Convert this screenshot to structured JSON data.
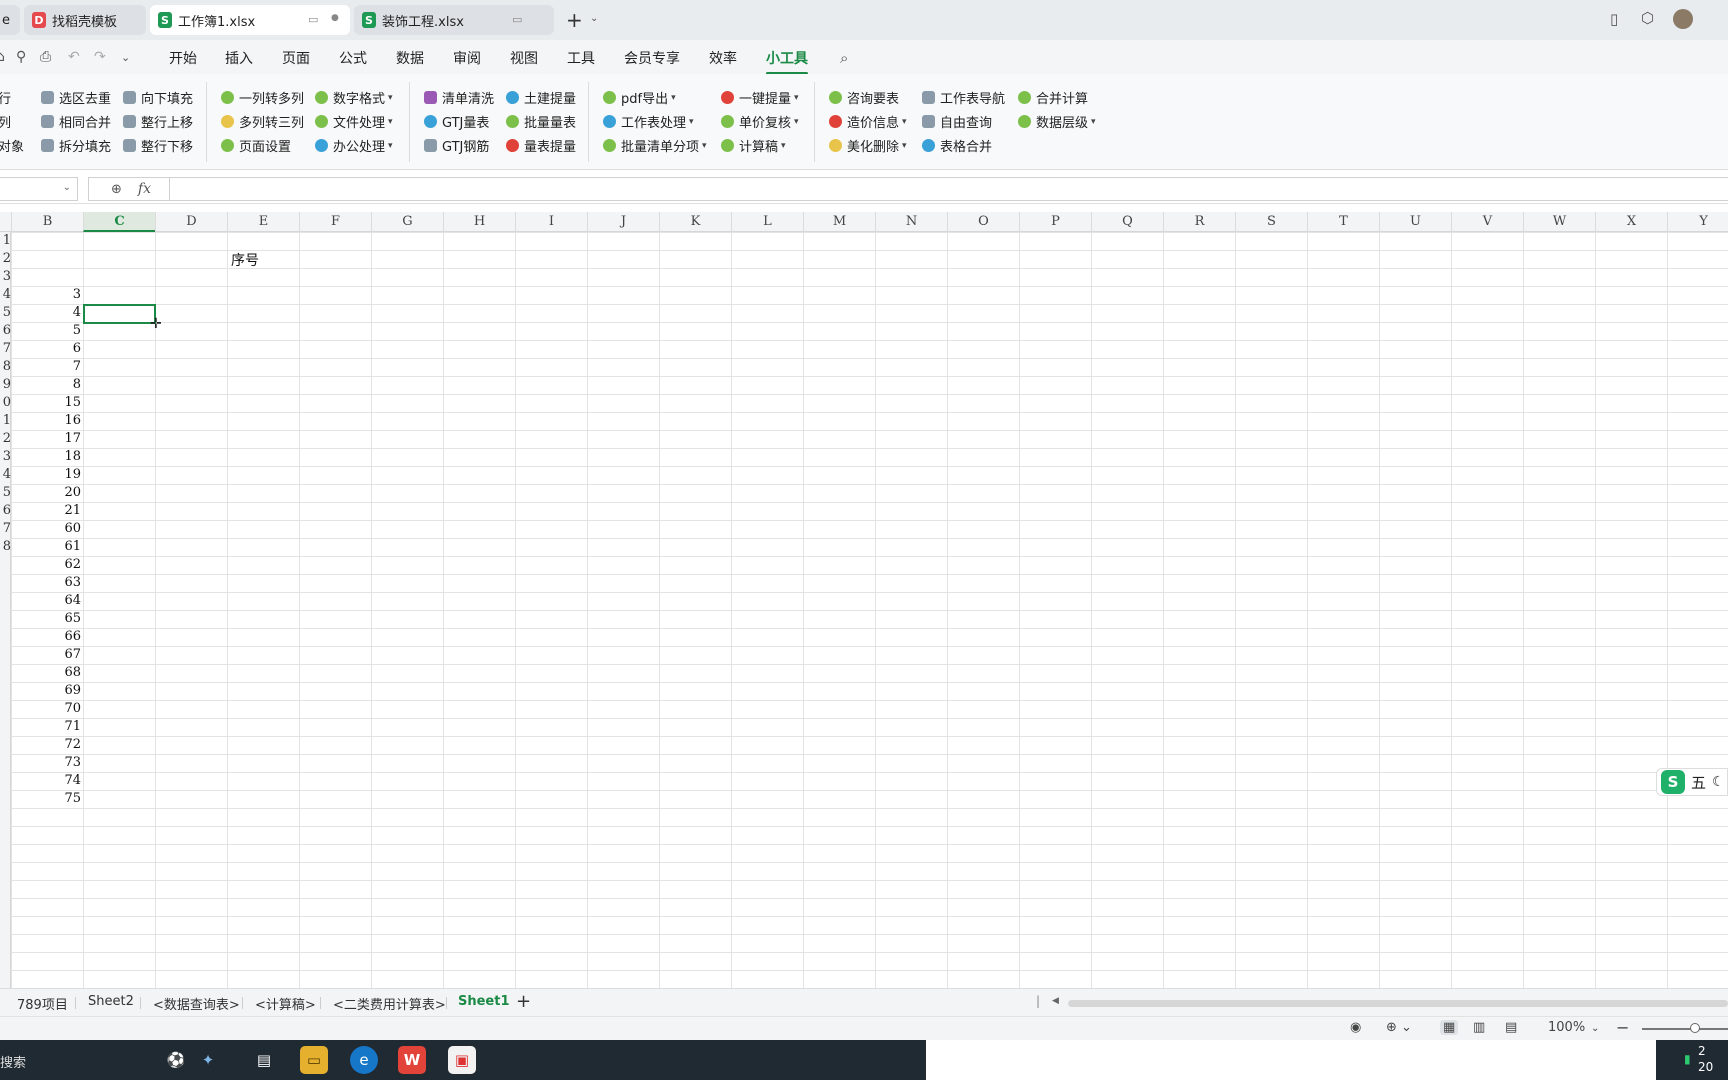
{
  "tabs": [
    {
      "label": "e",
      "kind": "partial"
    },
    {
      "label": "找稻壳模板",
      "icon": "D"
    },
    {
      "label": "工作簿1.xlsx",
      "icon": "S"
    },
    {
      "label": "装饰工程.xlsx",
      "icon": "S"
    }
  ],
  "menu": [
    "开始",
    "插入",
    "页面",
    "公式",
    "数据",
    "审阅",
    "视图",
    "工具",
    "会员专享",
    "效率",
    "小工具"
  ],
  "active_menu": "小工具",
  "ribbon": {
    "g0": [
      "行",
      "列",
      "对象"
    ],
    "g1": [
      "选区去重",
      "相同合并",
      "拆分填充"
    ],
    "g2": [
      "向下填充",
      "整行上移",
      "整行下移"
    ],
    "g3": [
      "一列转多列",
      "多列转三列",
      "页面设置"
    ],
    "g4": [
      "数字格式",
      "文件处理",
      "办公处理"
    ],
    "g5": [
      "清单清洗",
      "GTJ量表",
      "GTJ钢筋"
    ],
    "g6": [
      "土建提量",
      "批量量表",
      "量表提量"
    ],
    "g7": [
      "pdf导出",
      "工作表处理",
      "批量清单分项"
    ],
    "g8": [
      "一键提量",
      "单价复核",
      "计算稿"
    ],
    "g9": [
      "咨询要表",
      "造价信息",
      "美化删除"
    ],
    "g10": [
      "工作表导航",
      "自由查询",
      "表格合并"
    ],
    "g11": [
      "合并计算",
      "数据层级"
    ]
  },
  "formula": {
    "fx": "fx"
  },
  "columns": [
    "B",
    "C",
    "D",
    "E",
    "F",
    "G",
    "H",
    "I",
    "J",
    "K",
    "L",
    "M",
    "N",
    "O",
    "P",
    "Q",
    "R",
    "S",
    "T",
    "U",
    "V",
    "W",
    "X",
    "Y"
  ],
  "selected_column": "C",
  "row_numbers": [
    "1",
    "2",
    "3",
    "4",
    "5",
    "6",
    "7",
    "8",
    "9",
    "0",
    "1",
    "2",
    "3",
    "4",
    "5",
    "6",
    "7",
    "8"
  ],
  "column_b": [
    "",
    "",
    "",
    "3",
    "4",
    "5",
    "6",
    "7",
    "8",
    "15",
    "16",
    "17",
    "18",
    "19",
    "20",
    "21",
    "60",
    "61",
    "62",
    "63",
    "64",
    "65",
    "66",
    "67",
    "68",
    "69",
    "70",
    "71",
    "72",
    "73",
    "74",
    "75"
  ],
  "cell_e1": "序号",
  "ime": {
    "logo": "S",
    "label": "五"
  },
  "sheets": [
    "789项目",
    "Sheet2",
    "<数据查询表>",
    "<计算稿>",
    "<二类费用计算表>",
    "Sheet1"
  ],
  "active_sheet": "Sheet1",
  "status": {
    "zoom": "100%"
  },
  "taskbar": {
    "search": "搜索",
    "clock_top": "2",
    "clock_bottom": "20"
  },
  "colors": {
    "accent": "#1b8a46",
    "taskbar": "#1f2a33"
  }
}
